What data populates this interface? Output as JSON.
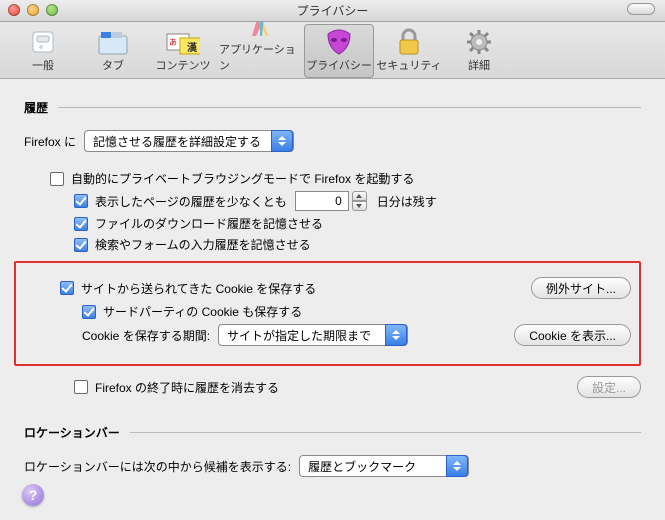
{
  "window": {
    "title": "プライバシー"
  },
  "toolbar": {
    "items": [
      {
        "label": "一般"
      },
      {
        "label": "タブ"
      },
      {
        "label": "コンテンツ"
      },
      {
        "label": "アプリケーション"
      },
      {
        "label": "プライバシー"
      },
      {
        "label": "セキュリティ"
      },
      {
        "label": "詳細"
      }
    ],
    "selected": 4
  },
  "sections": {
    "history": "履歴",
    "locationbar": "ロケーションバー"
  },
  "history": {
    "label_prefix": "Firefox に",
    "mode_select": "記憶させる履歴を詳細設定する",
    "auto_private": {
      "checked": false,
      "label": "自動的にプライベートブラウジングモードで Firefox を起動する"
    },
    "pages": {
      "checked": true,
      "label_pre": "表示したページの履歴を少なくとも",
      "value": "0",
      "label_post": "日分は残す"
    },
    "downloads": {
      "checked": true,
      "label": "ファイルのダウンロード履歴を記憶させる"
    },
    "forms": {
      "checked": true,
      "label": "検索やフォームの入力履歴を記憶させる"
    },
    "cookies": {
      "accept": {
        "checked": true,
        "label": "サイトから送られてきた Cookie を保存する"
      },
      "exceptions_btn": "例外サイト...",
      "third_party": {
        "checked": true,
        "label": "サードパーティの Cookie も保存する"
      },
      "keep_label": "Cookie を保存する期間:",
      "keep_select": "サイトが指定した期限まで",
      "show_btn": "Cookie を表示..."
    },
    "clear_on_close": {
      "checked": false,
      "label": "Firefox の終了時に履歴を消去する"
    },
    "clear_settings_btn": "設定..."
  },
  "locationbar": {
    "label": "ロケーションバーには次の中から候補を表示する:",
    "select": "履歴とブックマーク"
  },
  "help_glyph": "?"
}
